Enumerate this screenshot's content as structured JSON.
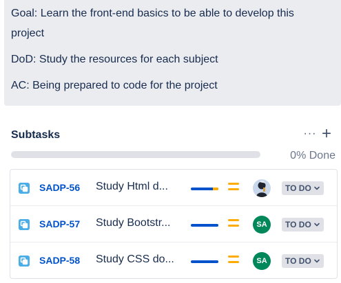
{
  "description": {
    "goal": "Goal: Learn the front-end basics to be able to develop this project",
    "goal_line1": "Goal: Learn the front-end basics to be able to develop this",
    "goal_line2": "project",
    "dod": "DoD: Study the resources for each subject",
    "ac": "AC: Being prepared to code for the project"
  },
  "subtasks": {
    "title": "Subtasks",
    "more_label": "···",
    "add_label": "+",
    "progress_label": "0% Done",
    "progress_fraction": 0.0,
    "items": [
      {
        "key": "SADP-56",
        "summary": "Study Html d...",
        "priority": "medium",
        "assignee_initials": "",
        "assignee_type": "photo",
        "status": "TO DO",
        "progress_blue": 0.8,
        "progress_yellow": 0.2
      },
      {
        "key": "SADP-57",
        "summary": "Study Bootstr...",
        "priority": "medium",
        "assignee_initials": "SA",
        "assignee_type": "initials",
        "status": "TO DO",
        "progress_blue": 1.0,
        "progress_yellow": 0.0
      },
      {
        "key": "SADP-58",
        "summary": "Study CSS do...",
        "priority": "medium",
        "assignee_initials": "SA",
        "assignee_type": "initials",
        "status": "TO DO",
        "progress_blue": 1.0,
        "progress_yellow": 0.0
      }
    ]
  },
  "colors": {
    "accent": "#0052cc",
    "subtask_icon": "#4bade8",
    "priority_medium": "#ffab00",
    "avatar_green": "#00875a",
    "lozenge_bg": "#dfe1e6",
    "panel_bg": "#ebecf0"
  },
  "icons": {
    "subtask": "subtask-icon",
    "priority": "priority-medium-icon",
    "more": "more-horizontal-icon",
    "add": "plus-icon",
    "chevron": "chevron-down-icon"
  }
}
